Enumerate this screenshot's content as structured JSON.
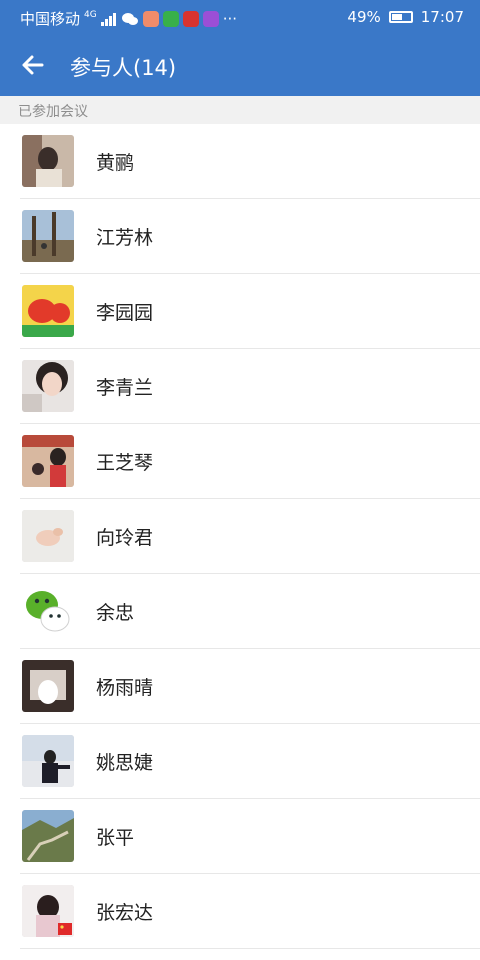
{
  "status_bar": {
    "carrier": "中国移动",
    "network": "4G",
    "battery": "49%",
    "time": "17:07",
    "more": "···"
  },
  "app_bar": {
    "title": "参与人(14)",
    "back_icon": "arrow-left"
  },
  "section": {
    "header": "已参加会议"
  },
  "participants": [
    {
      "name": "黄鹂"
    },
    {
      "name": "江芳林"
    },
    {
      "name": "李园园"
    },
    {
      "name": "李青兰"
    },
    {
      "name": "王芝琴"
    },
    {
      "name": "向玲君"
    },
    {
      "name": "余忠"
    },
    {
      "name": "杨雨晴"
    },
    {
      "name": "姚思婕"
    },
    {
      "name": "张平"
    },
    {
      "name": "张宏达"
    }
  ],
  "colors": {
    "primary": "#3a78c8",
    "section_bg": "#f1f1f1"
  }
}
